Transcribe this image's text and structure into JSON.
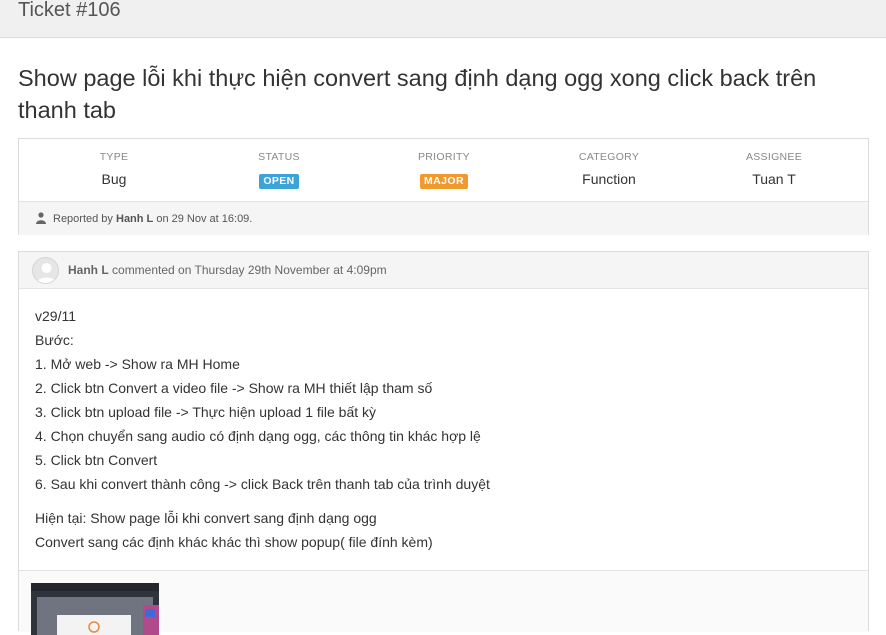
{
  "header": {
    "title": "Ticket #106"
  },
  "ticket": {
    "title": "Show page lỗi khi thực hiện convert sang định dạng ogg xong click back trên thanh tab",
    "fields": [
      {
        "label": "TYPE",
        "value": "Bug"
      },
      {
        "label": "STATUS",
        "value": "OPEN",
        "badge_color": "#3aa3d8"
      },
      {
        "label": "PRIORITY",
        "value": "MAJOR",
        "badge_color": "#ef9a2e"
      },
      {
        "label": "CATEGORY",
        "value": "Function"
      },
      {
        "label": "ASSIGNEE",
        "value": "Tuan T"
      }
    ],
    "reported": {
      "prefix": "Reported by",
      "user": "Hanh L",
      "suffix": "on 29 Nov at 16:09.",
      "icon": "user-icon"
    }
  },
  "comment": {
    "author": "Hanh L",
    "meta": "commented on Thursday 29th November at 4:09pm",
    "lines": [
      "v29/11",
      "Bước:",
      "1. Mở web -> Show ra MH Home",
      "2. Click btn Convert a video file -> Show ra MH thiết lập tham số",
      "3. Click btn upload file -> Thực hiện upload 1 file bất kỳ",
      "4. Chọn chuyển sang audio có định dạng ogg, các thông tin khác hợp lệ",
      "5. Click btn Convert",
      "6. Sau khi convert thành công -> click Back trên thanh tab của trình duyệt"
    ],
    "lines2": [
      "Hiện tại: Show page lỗi khi convert sang định dạng ogg",
      "Convert sang các định khác khác thì show popup( file đính kèm)"
    ]
  }
}
